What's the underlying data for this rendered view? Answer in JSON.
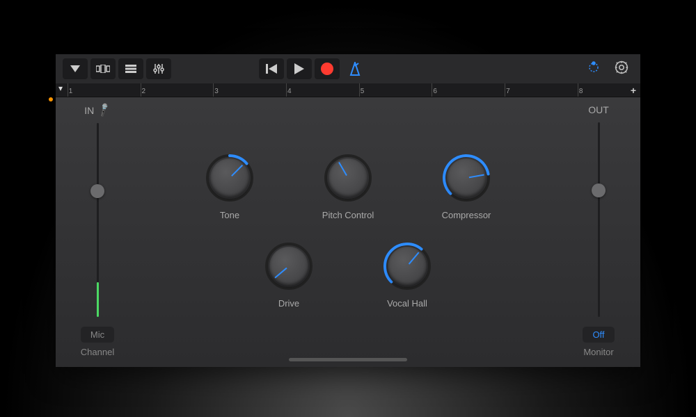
{
  "toolbar": {
    "ruler_bars": [
      "1",
      "2",
      "3",
      "4",
      "5",
      "6",
      "7",
      "8"
    ]
  },
  "input": {
    "label": "IN",
    "slider_position_pct": 65,
    "level_pct": 18,
    "button": "Mic",
    "sub": "Channel"
  },
  "output": {
    "label": "OUT",
    "slider_position_pct": 65,
    "button": "Off",
    "sub": "Monitor"
  },
  "knobs": {
    "row1": [
      {
        "label": "Tone",
        "angle": 45,
        "arc_start": 0,
        "arc_end": 50
      },
      {
        "label": "Pitch Control",
        "angle": -30,
        "arc_start": 0,
        "arc_end": 0
      },
      {
        "label": "Compressor",
        "angle": 80,
        "arc_start": -135,
        "arc_end": 80
      }
    ],
    "row2": [
      {
        "label": "Drive",
        "angle": -130,
        "arc_start": 0,
        "arc_end": 0
      },
      {
        "label": "Vocal Hall",
        "angle": 40,
        "arc_start": -135,
        "arc_end": 40
      }
    ]
  },
  "colors": {
    "accent": "#2e8dff",
    "record": "#ff3b30",
    "level": "#4cd964"
  }
}
